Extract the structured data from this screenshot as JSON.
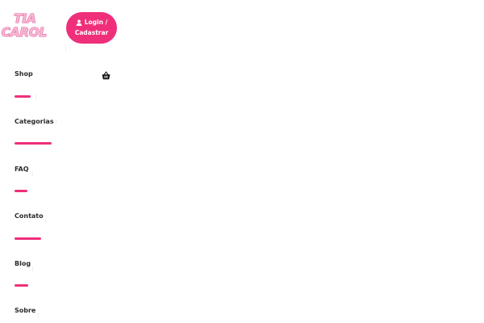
{
  "header": {
    "logo": {
      "line1": "TIA",
      "line2": "CAROL",
      "fill_color": "#f7b7d3",
      "stroke_color": "#e05c9b"
    },
    "login_button": {
      "icon": "user-icon",
      "line1": "Login /",
      "line2": "Cadastrar",
      "color": "#ef2f7a"
    },
    "cart": {
      "icon": "shopping-basket-icon"
    }
  },
  "nav": {
    "items": [
      {
        "label": "Shop"
      },
      {
        "label": "Categorias"
      },
      {
        "label": "FAQ"
      },
      {
        "label": "Contato"
      },
      {
        "label": "Blog"
      },
      {
        "label": "Sobre"
      }
    ],
    "accent_color": "#ef2f7a"
  }
}
